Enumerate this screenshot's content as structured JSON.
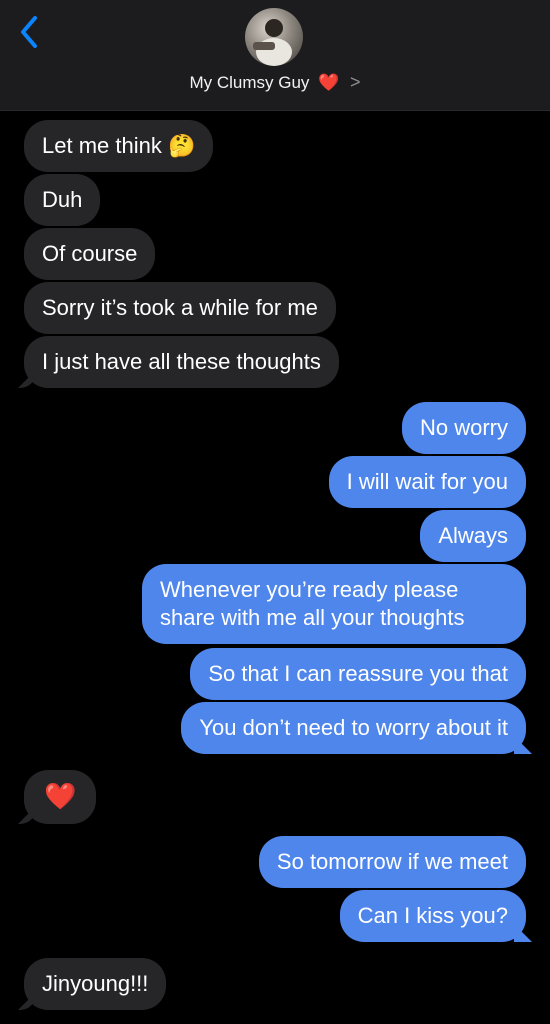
{
  "header": {
    "contact_name": "My Clumsy Guy",
    "contact_heart": "❤️",
    "chevron": ">",
    "back_icon": "chevron-left-icon"
  },
  "messages": [
    {
      "side": "received",
      "text": "Let me think 🤔"
    },
    {
      "side": "received",
      "text": "Duh"
    },
    {
      "side": "received",
      "text": "Of course"
    },
    {
      "side": "received",
      "text": "Sorry it’s took a while for me"
    },
    {
      "side": "received",
      "text": "I just have all these thoughts"
    },
    {
      "side": "sent",
      "text": "No worry"
    },
    {
      "side": "sent",
      "text": "I will wait for you"
    },
    {
      "side": "sent",
      "text": "Always"
    },
    {
      "side": "sent",
      "text": "Whenever you’re ready please share with me all your thoughts"
    },
    {
      "side": "sent",
      "text": "So that I can reassure you that"
    },
    {
      "side": "sent",
      "text": "You don’t need to worry about it"
    },
    {
      "side": "received",
      "text": "❤️"
    },
    {
      "side": "sent",
      "text": "So tomorrow if we meet"
    },
    {
      "side": "sent",
      "text": "Can I kiss you?"
    },
    {
      "side": "received",
      "text": "Jinyoung!!!"
    }
  ],
  "colors": {
    "sent_bubble": "#4f86ec",
    "received_bubble": "#262628",
    "background": "#000000",
    "accent": "#0a84ff"
  }
}
